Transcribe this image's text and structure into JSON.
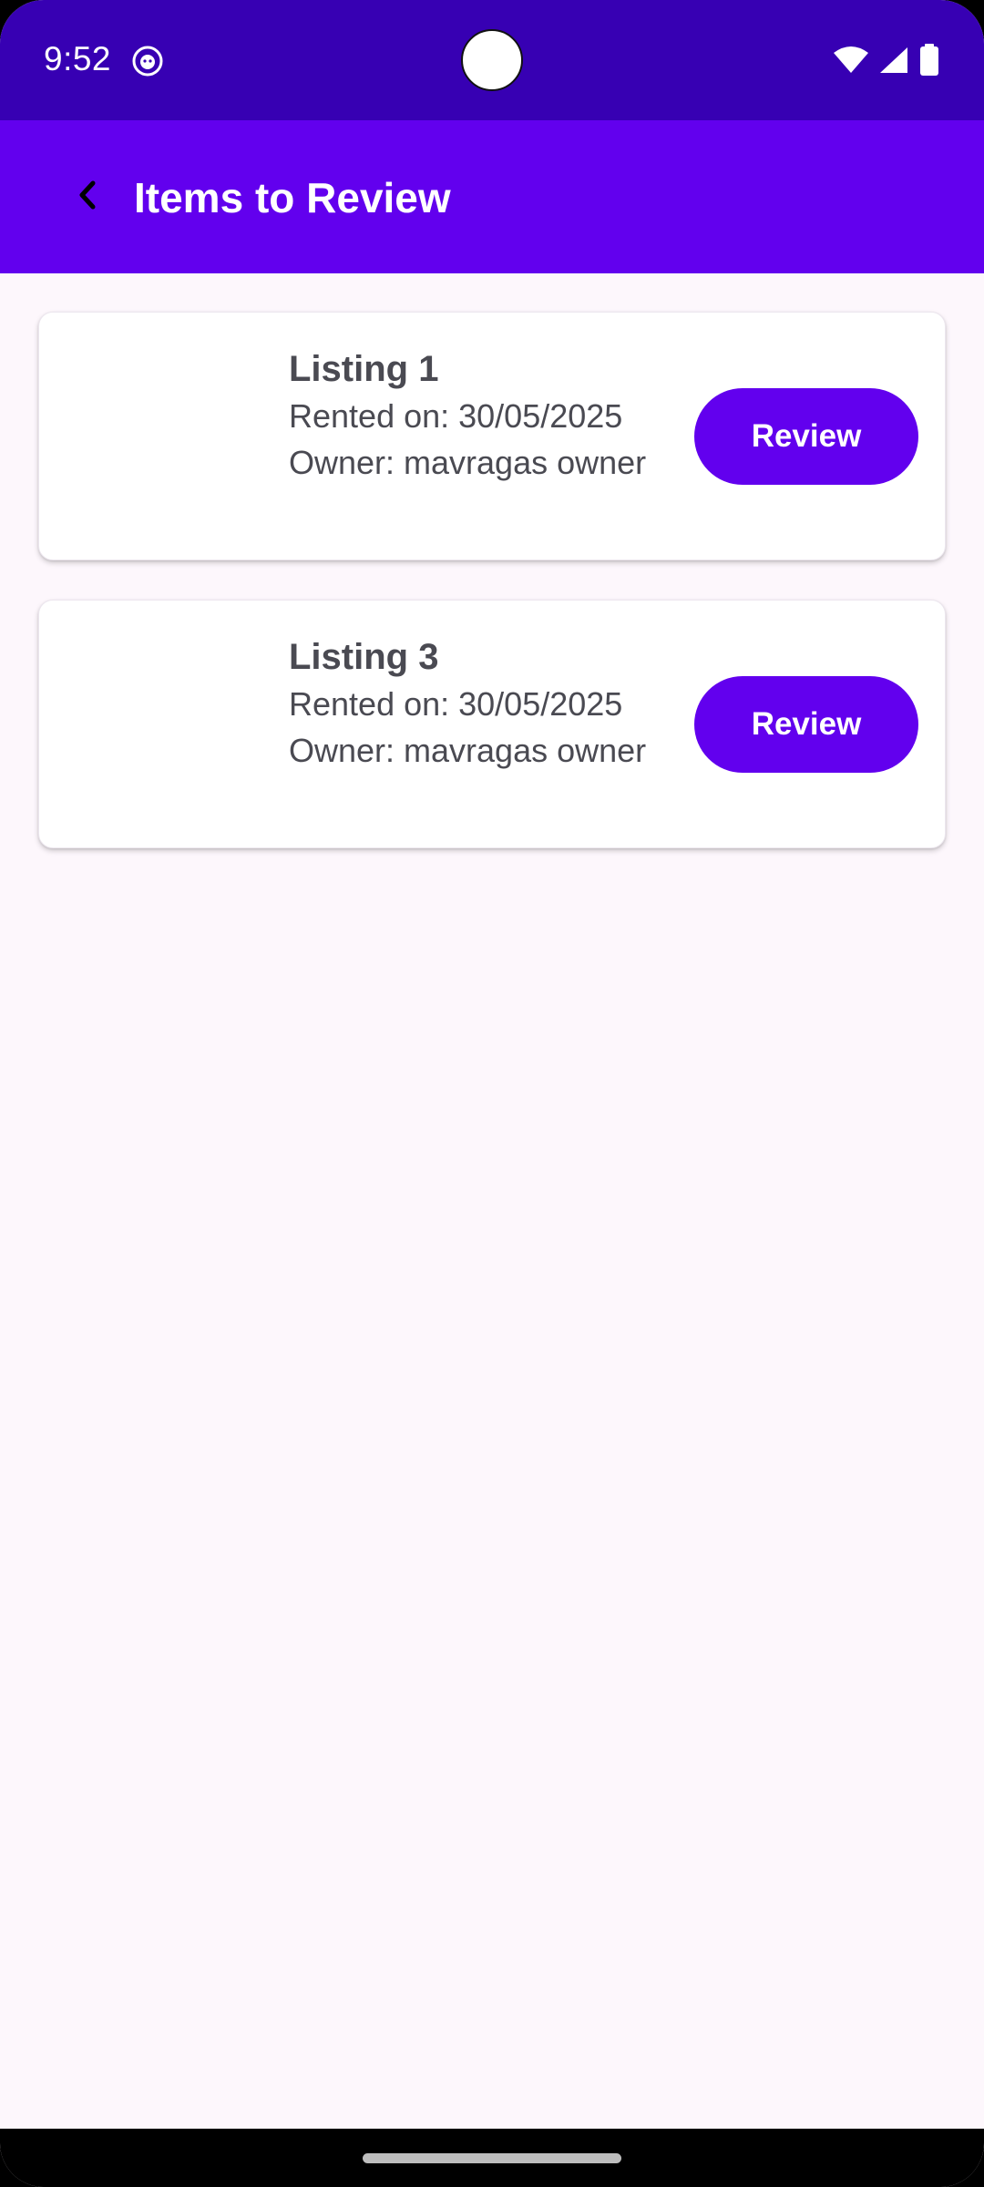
{
  "status_bar": {
    "time": "9:52",
    "icons": [
      "app-notification-icon",
      "wifi-icon",
      "cellular-signal-icon",
      "battery-icon"
    ]
  },
  "app_bar": {
    "title": "Items to Review",
    "back_icon": "chevron-left-icon"
  },
  "colors": {
    "status_bar": "#3700b3",
    "primary": "#6200ee",
    "background": "#fdf7fc",
    "card": "#ffffff",
    "text": "#4a4a52"
  },
  "items": [
    {
      "title": "Listing 1",
      "rented": "Rented on: 30/05/2025",
      "owner": "Owner: mavragas owner",
      "button": "Review"
    },
    {
      "title": "Listing 3",
      "rented": "Rented on: 30/05/2025",
      "owner": "Owner: mavragas owner",
      "button": "Review"
    }
  ]
}
